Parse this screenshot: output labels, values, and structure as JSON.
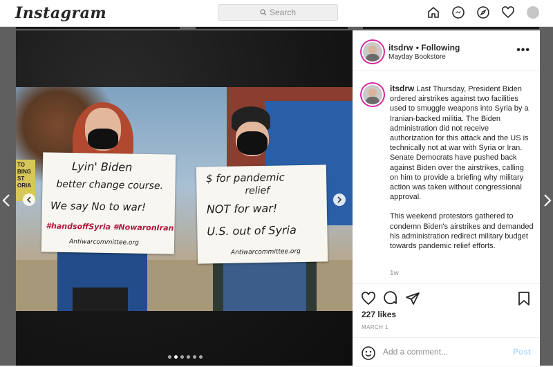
{
  "app": {
    "logo": "Instagram"
  },
  "search": {
    "placeholder": "Search"
  },
  "nav": {
    "icons": [
      "home-icon",
      "messenger-icon",
      "explore-icon",
      "heart-icon",
      "profile-avatar"
    ]
  },
  "post": {
    "username": "itsdrw",
    "follow_label": "Following",
    "location": "Mayday Bookstore",
    "more_label": "•••",
    "caption": {
      "username": "itsdrw",
      "paragraph1": "Last Thursday, President Biden ordered airstrikes against two facilities used to smuggle weapons into Syria by a Iranian-backed militia. The Biden administration did not receive authorization for this attack and the US is technically not at war with Syria or Iran. Senate Democrats have pushed back against Biden over the airstrikes, calling on him to provide a briefing why military action was taken without congressional approval.",
      "paragraph2": "This weekend protestors gathered to condemn Biden's airstrikes and demanded his administration redirect military budget towards pandemic relief efforts."
    },
    "caption_time": "1w",
    "likes": "227 likes",
    "date": "MARCH 1",
    "comment_placeholder": "Add a comment...",
    "post_label": "Post",
    "carousel": {
      "count": 6,
      "active": 1
    },
    "sign_left": [
      "Lyin' Biden",
      "better change course.",
      "We say No to war!",
      "#handsoffSyria #NowaronIran",
      "Antiwarcommittee.org"
    ],
    "sign_right": [
      "$ for pandemic",
      "relief",
      "NOT for war!",
      "U.S. out of Syria",
      "Antiwarcommittee.org"
    ],
    "bg_sign": [
      "TO",
      "BING",
      "ST",
      "ORIA"
    ]
  },
  "colors": {
    "story_ring": "#d6249f",
    "post_button": "#b3dbff",
    "accent": "#0095f6"
  }
}
